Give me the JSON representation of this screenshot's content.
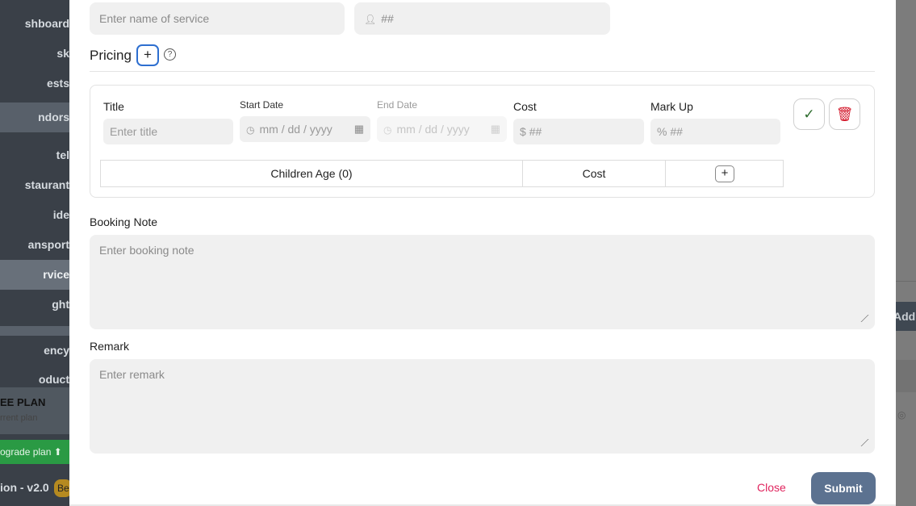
{
  "sidebar": {
    "items": [
      {
        "label": "shboard"
      },
      {
        "label": "sk"
      },
      {
        "label": "ests"
      },
      {
        "label": "ndors"
      },
      {
        "label": "tel"
      },
      {
        "label": "staurant"
      },
      {
        "label": "ide"
      },
      {
        "label": "ansport"
      },
      {
        "label": "rvice"
      },
      {
        "label": "ght"
      },
      {
        "label": "ency"
      },
      {
        "label": "oduct"
      }
    ],
    "plan_title": "EE PLAN",
    "plan_subtitle": "rrent plan",
    "upgrade_label": "ograde plan",
    "version": "ion - v2.0",
    "badge": "Be"
  },
  "background": {
    "add_label": "Add"
  },
  "form": {
    "service_name_placeholder": "Enter name of service",
    "pax_placeholder": "##",
    "pricing_label": "Pricing",
    "pricing": {
      "title_label": "Title",
      "title_placeholder": "Enter title",
      "start_date_label": "Start Date",
      "start_date_placeholder": "mm / dd / yyyy",
      "end_date_label": "End Date",
      "end_date_placeholder": "mm / dd / yyyy",
      "cost_label": "Cost",
      "cost_prefix": "$",
      "cost_placeholder": "##",
      "markup_label": "Mark Up",
      "markup_prefix": "%",
      "markup_placeholder": "##",
      "children_age_header": "Children Age (0)",
      "children_cost_header": "Cost"
    },
    "booking_note_label": "Booking Note",
    "booking_note_placeholder": "Enter booking note",
    "remark_label": "Remark",
    "remark_placeholder": "Enter remark"
  },
  "actions": {
    "close_label": "Close",
    "submit_label": "Submit"
  },
  "colors": {
    "accent_blue": "#2e6fd0",
    "submit_bg": "#5c7290",
    "close_text": "#e0245e",
    "delete_red": "#d4182b",
    "check_green": "#2c6b2c"
  }
}
